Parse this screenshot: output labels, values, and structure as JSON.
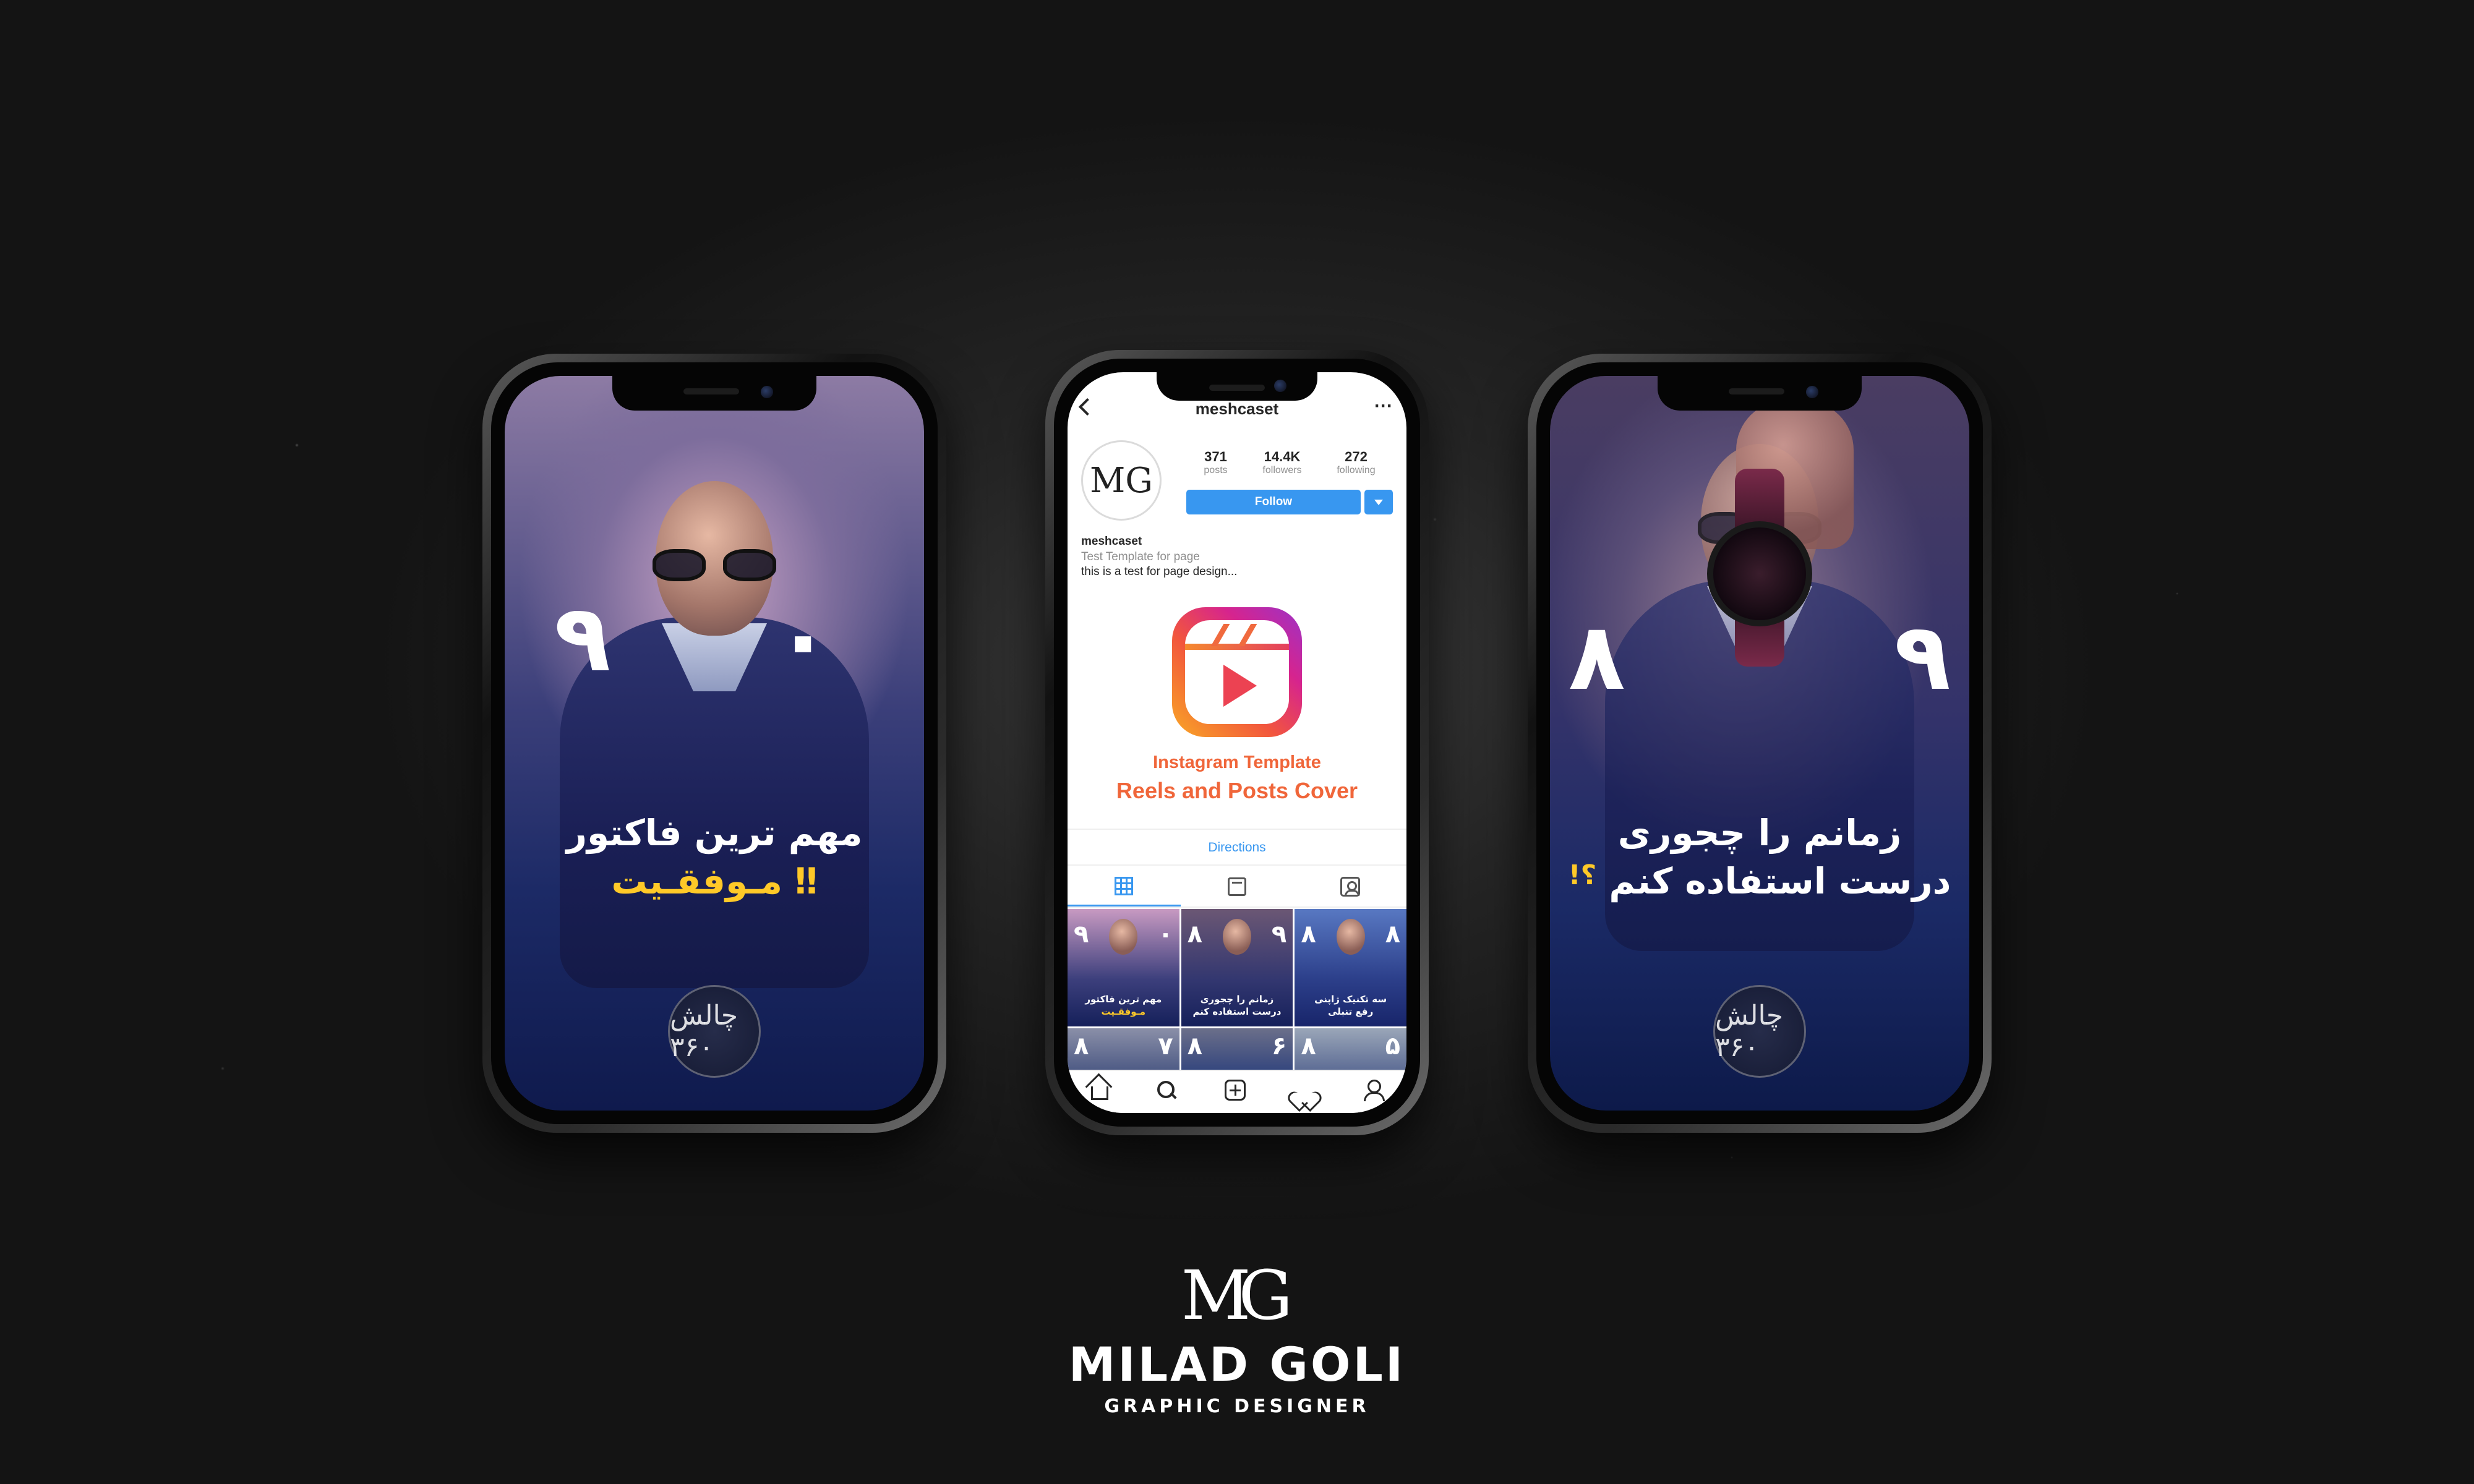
{
  "left_story": {
    "number_left": "۹",
    "number_right": "۰",
    "title_line1": "مهم ترین فاکتور",
    "title_line2": "مـوفقـیت",
    "title_mark": "‼",
    "badge": "چالش ۳۶۰"
  },
  "right_story": {
    "number_left": "۸",
    "number_right": "۹",
    "title_line1": "زمانم را چجوری",
    "title_line2": "درست استفاده کنم",
    "title_mark": "؟!",
    "badge": "چالش ۳۶۰"
  },
  "instagram": {
    "username": "meshcaset",
    "more": "···",
    "avatar_monogram": "MG",
    "stats": [
      {
        "value": "371",
        "label": "posts"
      },
      {
        "value": "14.4K",
        "label": "followers"
      },
      {
        "value": "272",
        "label": "following"
      }
    ],
    "follow_label": "Follow",
    "bio_name": "meshcaset",
    "bio_category": "Test Template for page",
    "bio_text": "this is a test for page design...",
    "promo_line1": "Instagram Template",
    "promo_line2": "Reels and Posts Cover",
    "directions": "Directions",
    "grid": [
      {
        "caption1": "مهم ترین فاکتور",
        "caption2": "مـوفقـیت",
        "num_l": "۹",
        "num_r": "۰"
      },
      {
        "caption1": "زمانم را چجوری",
        "caption2": "درست استفاده کنم",
        "num_l": "۸",
        "num_r": "۹"
      },
      {
        "caption1": "سه تکنیک ژاپنی",
        "caption2": "رفع تنبلی",
        "num_l": "۸",
        "num_r": "۸"
      },
      {
        "num_l": "۸",
        "num_r": "۷"
      },
      {
        "num_l": "۸",
        "num_r": "۶"
      },
      {
        "num_l": "۸",
        "num_r": "۵"
      }
    ]
  },
  "brand": {
    "monogram": "MG",
    "name": "MILAD GOLI",
    "role": "GRAPHIC DESIGNER"
  },
  "colors": {
    "accent_yellow": "#ffc928",
    "instagram_blue": "#3897f0",
    "promo_orange": "#f0663a"
  }
}
